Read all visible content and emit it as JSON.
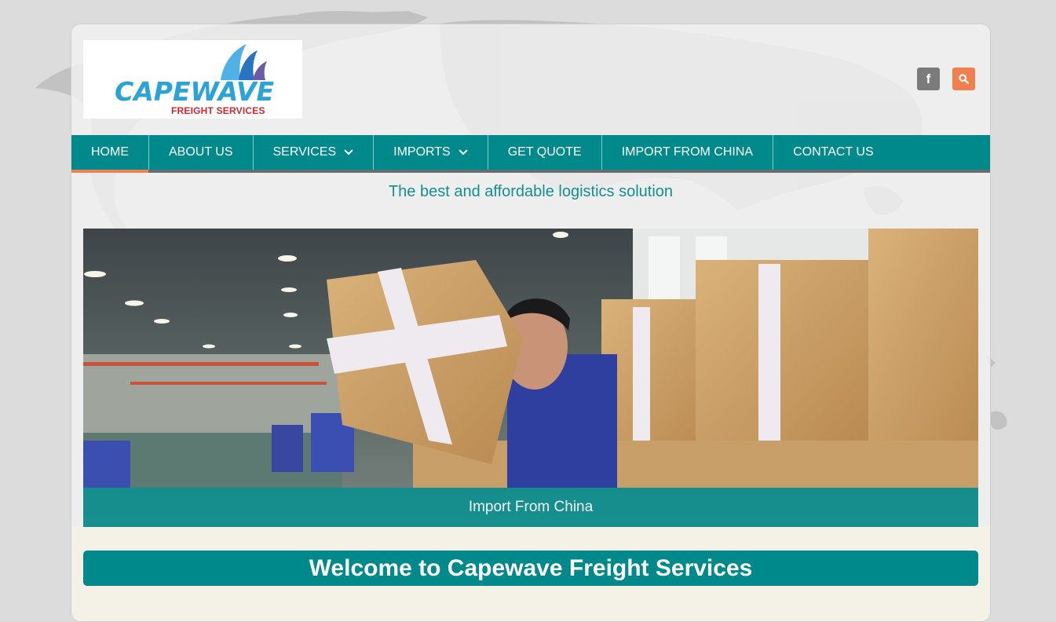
{
  "brand": {
    "name": "CAPEWAVE",
    "subtitle": "FREIGHT SERVICES"
  },
  "header": {
    "social": [
      {
        "icon": "facebook-icon",
        "glyph": "f"
      },
      {
        "icon": "search-icon"
      }
    ]
  },
  "nav": {
    "items": [
      {
        "label": "HOME",
        "active": true,
        "dropdown": false
      },
      {
        "label": "ABOUT US",
        "active": false,
        "dropdown": false
      },
      {
        "label": "SERVICES",
        "active": false,
        "dropdown": true
      },
      {
        "label": "IMPORTS",
        "active": false,
        "dropdown": true
      },
      {
        "label": "GET QUOTE",
        "active": false,
        "dropdown": false
      },
      {
        "label": "IMPORT FROM CHINA",
        "active": false,
        "dropdown": false
      },
      {
        "label": "CONTACT US",
        "active": false,
        "dropdown": false
      }
    ]
  },
  "tagline": "The best and affordable logistics solution",
  "hero": {
    "caption": "Import From China"
  },
  "welcome": "Welcome to Capewave Freight Services",
  "colors": {
    "primary": "#00898a",
    "accent": "#f0814f",
    "logo_blue": "#2ba3d9",
    "logo_red": "#d6262d"
  }
}
